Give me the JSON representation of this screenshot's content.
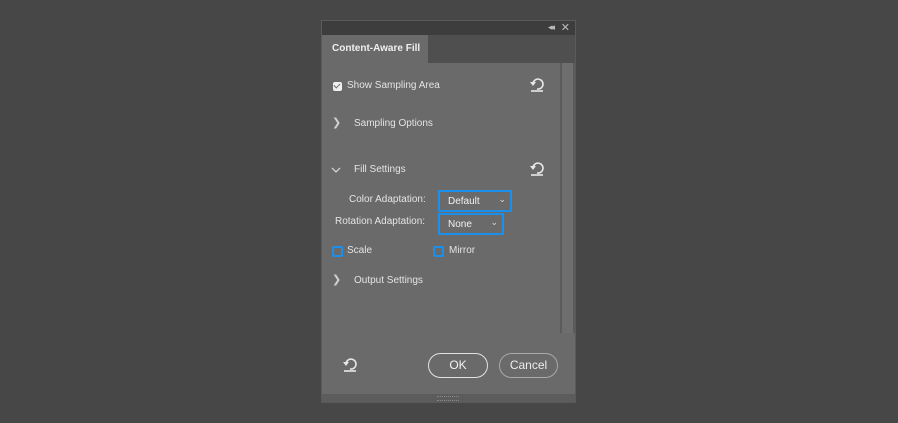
{
  "panel": {
    "tab_title": "Content-Aware Fill",
    "collapse_glyph": "◂◂",
    "close_glyph": "✕"
  },
  "show_sampling_area": {
    "label": "Show Sampling Area",
    "checked": true
  },
  "sampling_options": {
    "label": "Sampling Options",
    "expanded": false
  },
  "fill_settings": {
    "label": "Fill Settings",
    "expanded": true,
    "color_adaptation": {
      "label": "Color Adaptation:",
      "value": "Default"
    },
    "rotation_adaptation": {
      "label": "Rotation Adaptation:",
      "value": "None"
    },
    "scale": {
      "label": "Scale",
      "checked": false
    },
    "mirror": {
      "label": "Mirror",
      "checked": false
    }
  },
  "output_settings": {
    "label": "Output Settings",
    "expanded": false
  },
  "footer": {
    "ok_label": "OK",
    "cancel_label": "Cancel"
  },
  "icons": {
    "reset": "reset-icon",
    "chevron_right": "chevron-right-icon",
    "chevron_down": "chevron-down-icon"
  },
  "colors": {
    "accent": "#1c8fea",
    "panel_bg": "#6a6a6a",
    "app_bg": "#474747"
  }
}
